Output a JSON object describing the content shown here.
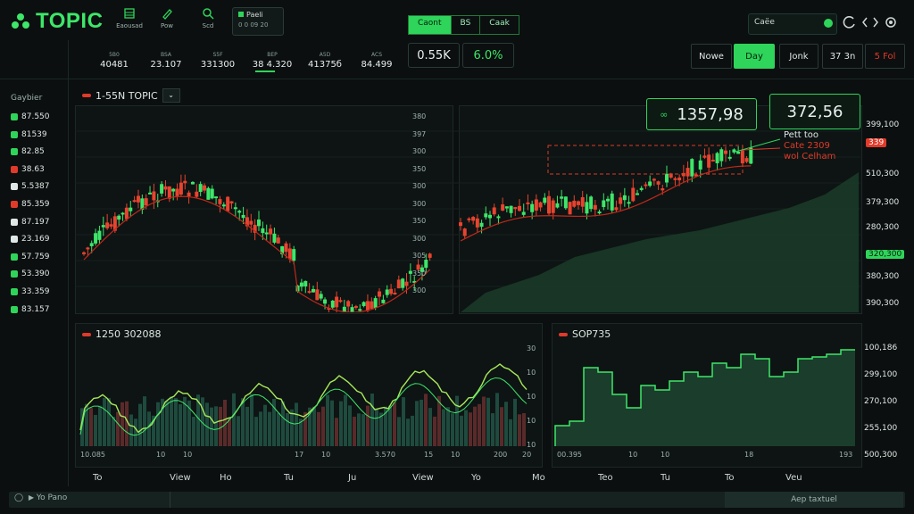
{
  "app": {
    "title": "TOPIC"
  },
  "toolbar": {
    "nav": [
      {
        "label": "Eaousad",
        "icon": "building-icon"
      },
      {
        "label": "Pow",
        "icon": "pencil-icon"
      },
      {
        "label": "Scd",
        "icon": "search-icon"
      }
    ],
    "select_label": "Paeli",
    "select_value": "0 0 09 20"
  },
  "segments": [
    "Caont",
    "BS",
    "Caak"
  ],
  "search": {
    "placeholder": "Caëe"
  },
  "tickers": [
    {
      "label": "5B0",
      "value": "40481"
    },
    {
      "label": "BSA",
      "value": "23.107"
    },
    {
      "label": "S5F",
      "value": "331300"
    },
    {
      "label": "BEP",
      "value": "38 4.320"
    },
    {
      "label": "A5D",
      "value": "41375б"
    },
    {
      "label": "ACS",
      "value": "84.499"
    }
  ],
  "stats": {
    "left": "0.55K",
    "right": "6.0%"
  },
  "ranges": [
    "Nowe",
    "Day",
    "Jonk",
    "37 3n",
    "5 Fol"
  ],
  "active_range": "Day",
  "sidebar": {
    "title": "Gaybier",
    "items": [
      {
        "value": "87.550",
        "color": "#2fd45a"
      },
      {
        "value": "81539",
        "color": "#2fd45a"
      },
      {
        "value": "82.85",
        "color": "#2fd45a"
      },
      {
        "value": "38.63",
        "color": "#e03a2a"
      },
      {
        "value": "5.5387",
        "color": "#dfe8e5"
      },
      {
        "value": "85.359",
        "color": "#e03a2a"
      },
      {
        "value": "87.197",
        "color": "#dfe8e5"
      },
      {
        "value": "23.169",
        "color": "#dfe8e5"
      },
      {
        "value": "57.759",
        "color": "#2fd45a"
      },
      {
        "value": "53.390",
        "color": "#2fd45a"
      },
      {
        "value": "33.359",
        "color": "#2fd45a"
      },
      {
        "value": "83.157",
        "color": "#2fd45a"
      }
    ]
  },
  "main_chart": {
    "title": "1-55N TOPIC",
    "ylabels": [
      "380",
      "397",
      "300",
      "350",
      "300",
      "300",
      "350",
      "300",
      "305",
      "350",
      "300"
    ],
    "price_a": "1357,98",
    "price_b": "372,56",
    "annotation": [
      "Pett too",
      "Cate 2309",
      "wol Celham"
    ],
    "right_labels": [
      "399,100",
      "339",
      "510,300",
      "379,300",
      "280,300",
      "320,300",
      "380,300",
      "390,300"
    ]
  },
  "lower_left": {
    "title": "1250 302088",
    "xlabels": [
      "10.085",
      "10",
      "10",
      "17",
      "10",
      "3.570",
      "15",
      "10",
      "200",
      "20"
    ],
    "ylabels": [
      "30",
      "10",
      "10",
      "10",
      "10"
    ]
  },
  "lower_right": {
    "title": "SOP735",
    "xlabels": [
      "00.395",
      "10",
      "10",
      "18",
      "193"
    ],
    "ylabels": [
      "100,186",
      "299,100",
      "270,100",
      "255,100",
      "500,300"
    ]
  },
  "time_axis": [
    "To",
    "View",
    "Ho",
    "Tu",
    "Ju",
    "View",
    "Yo",
    "Mo",
    "Teo",
    "Tu",
    "To",
    "Veu"
  ],
  "bottom": {
    "left": "Yo Pano",
    "right": "Aep taxtuel"
  },
  "colors": {
    "accent": "#2fd45a",
    "down": "#e03a2a",
    "bg": "#0b0f0f"
  }
}
